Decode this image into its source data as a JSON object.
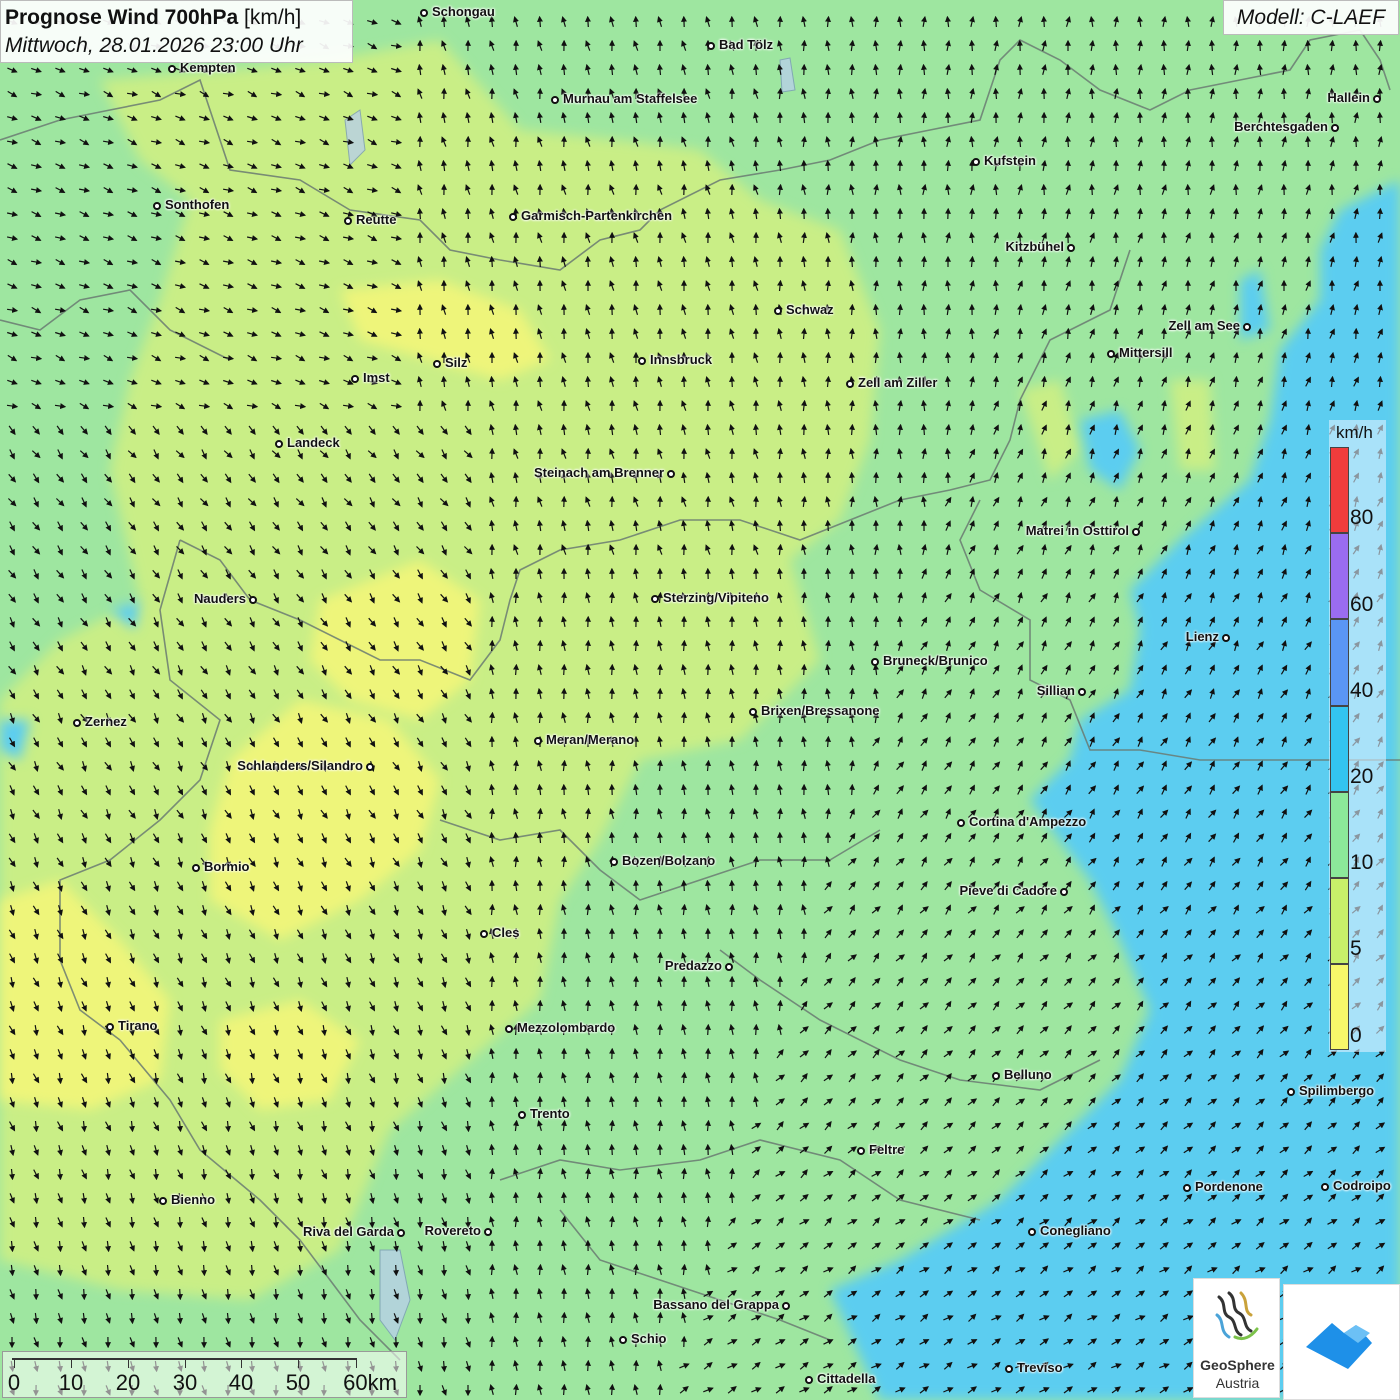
{
  "header": {
    "title_bold": "Prognose Wind 700hPa",
    "title_unit": "[km/h]",
    "subtitle": "Mittwoch, 28.01.2026 23:00 Uhr"
  },
  "model_label": "Modell: C-LAEF",
  "legend": {
    "unit": "km/h",
    "ticks": [
      "80",
      "60",
      "40",
      "20",
      "10",
      "5",
      "0"
    ],
    "bands": [
      {
        "label": "80",
        "color": "#f03c3c"
      },
      {
        "label": "60",
        "color": "#9a6cf0"
      },
      {
        "label": "40",
        "color": "#5a96f5"
      },
      {
        "label": "20",
        "color": "#33c4f0"
      },
      {
        "label": "10",
        "color": "#8ce89a"
      },
      {
        "label": "5",
        "color": "#c8f06a"
      },
      {
        "label": "0",
        "color": "#f7f76a"
      }
    ]
  },
  "scale_bar": {
    "labels": [
      "0",
      "10",
      "20",
      "30",
      "40",
      "50",
      "60km"
    ]
  },
  "logos": {
    "geosphere_name": "GeoSphere",
    "geosphere_sub": "Austria"
  },
  "cities": [
    {
      "name": "Schongau"
    },
    {
      "name": "Bad Tölz"
    },
    {
      "name": "Kempten"
    },
    {
      "name": "Murnau am Staffelsee"
    },
    {
      "name": "Hallein"
    },
    {
      "name": "Berchtesgaden"
    },
    {
      "name": "Kufstein"
    },
    {
      "name": "Sonthofen"
    },
    {
      "name": "Reutte"
    },
    {
      "name": "Garmisch-Partenkirchen"
    },
    {
      "name": "Kitzbühel"
    },
    {
      "name": "Schwaz"
    },
    {
      "name": "Zell am See"
    },
    {
      "name": "Innsbruck"
    },
    {
      "name": "Mittersill"
    },
    {
      "name": "Silz"
    },
    {
      "name": "Imst"
    },
    {
      "name": "Zell am Ziller"
    },
    {
      "name": "Landeck"
    },
    {
      "name": "Steinach am Brenner"
    },
    {
      "name": "Matrei in Osttirol"
    },
    {
      "name": "Nauders"
    },
    {
      "name": "Sterzing/Vipiteno"
    },
    {
      "name": "Lienz"
    },
    {
      "name": "Bruneck/Brunico"
    },
    {
      "name": "Sillian"
    },
    {
      "name": "Zernez"
    },
    {
      "name": "Brixen/Bressanone"
    },
    {
      "name": "Meran/Merano"
    },
    {
      "name": "Schlanders/Silandro"
    },
    {
      "name": "Cortina d'Ampezzo"
    },
    {
      "name": "Bozen/Bolzano"
    },
    {
      "name": "Bormio"
    },
    {
      "name": "Pieve di Cadore"
    },
    {
      "name": "Cles"
    },
    {
      "name": "Predazzo"
    },
    {
      "name": "Tirano"
    },
    {
      "name": "Mezzolombardo"
    },
    {
      "name": "Belluno"
    },
    {
      "name": "Spilimbergo"
    },
    {
      "name": "Trento"
    },
    {
      "name": "Feltre"
    },
    {
      "name": "Pordenone"
    },
    {
      "name": "Codroipo"
    },
    {
      "name": "Bienno"
    },
    {
      "name": "Riva del Garda"
    },
    {
      "name": "Rovereto"
    },
    {
      "name": "Conegliano"
    },
    {
      "name": "Bassano del Grappa"
    },
    {
      "name": "Schio"
    },
    {
      "name": "Treviso"
    },
    {
      "name": "Cittadella"
    }
  ]
}
